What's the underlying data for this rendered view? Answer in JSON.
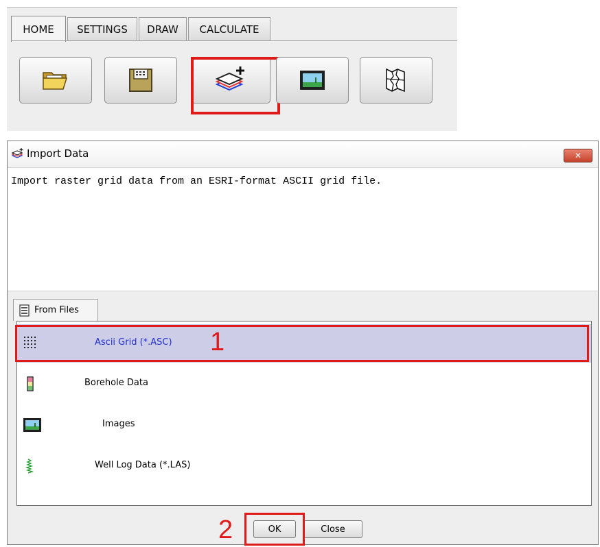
{
  "toolbar": {
    "tabs": [
      {
        "label": "HOME"
      },
      {
        "label": "SETTINGS"
      },
      {
        "label": "DRAW"
      },
      {
        "label": "CALCULATE"
      }
    ],
    "buttons": [
      {
        "icon": "open-folder-icon"
      },
      {
        "icon": "save-floppy-icon"
      },
      {
        "icon": "import-layers-icon"
      },
      {
        "icon": "image-icon"
      },
      {
        "icon": "map-icon"
      }
    ]
  },
  "dialog": {
    "title": "Import Data",
    "description": "Import raster grid data from an ESRI-format ASCII grid file.",
    "files_tab": "From Files",
    "items": [
      {
        "label": "Ascii Grid (*.ASC)",
        "icon": "dot-grid-icon",
        "selected": true
      },
      {
        "label": "Borehole Data",
        "icon": "borehole-icon",
        "selected": false
      },
      {
        "label": "Images",
        "icon": "image-icon",
        "selected": false
      },
      {
        "label": "Well Log Data (*.LAS)",
        "icon": "well-log-icon",
        "selected": false
      }
    ],
    "ok_label": "OK",
    "close_label": "Close",
    "close_x": "✕"
  },
  "annotations": {
    "marker1": "1",
    "marker2": "2"
  },
  "colors": {
    "highlight": "#e01919",
    "selected_row": "#cdcde8",
    "selected_text": "#1f2fd0"
  }
}
